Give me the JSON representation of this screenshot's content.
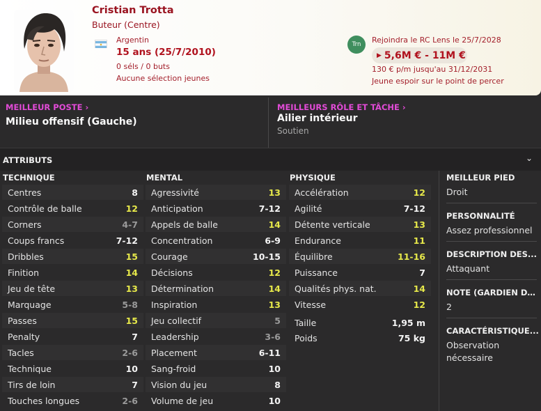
{
  "player": {
    "name": "Cristian Trotta",
    "position": "Buteur (Centre)",
    "nationality": "Argentin",
    "age": "15 ans (25/7/2010)",
    "caps": "0 séls / 0 buts",
    "youth_caps": "Aucune sélection jeunes"
  },
  "transfer": {
    "badge": "Trn",
    "club_move": "Rejoindra le RC Lens le 25/7/2028",
    "value": "5,6M € - 11M €",
    "wage": "130 € p/m jusqu'au 31/12/2031",
    "potential": "Jeune espoir sur le point de percer"
  },
  "best_position": {
    "label": "MEILLEUR POSTE",
    "value": "Milieu offensif (Gauche)"
  },
  "best_role": {
    "label": "MEILLEURS RÔLE ET TÂCHE",
    "value": "Ailier intérieur",
    "duty": "Soutien"
  },
  "attributes": {
    "title": "ATTRIBUTS",
    "technique_label": "TECHNIQUE",
    "mental_label": "MENTAL",
    "physique_label": "PHYSIQUE",
    "technique": [
      {
        "name": "Centres",
        "value": "8",
        "tone": "white"
      },
      {
        "name": "Contrôle de balle",
        "value": "12",
        "tone": "yellow"
      },
      {
        "name": "Corners",
        "value": "4-7",
        "tone": "grey"
      },
      {
        "name": "Coups francs",
        "value": "7-12",
        "tone": "white"
      },
      {
        "name": "Dribbles",
        "value": "15",
        "tone": "yellow"
      },
      {
        "name": "Finition",
        "value": "14",
        "tone": "yellow"
      },
      {
        "name": "Jeu de tête",
        "value": "13",
        "tone": "yellow"
      },
      {
        "name": "Marquage",
        "value": "5-8",
        "tone": "grey"
      },
      {
        "name": "Passes",
        "value": "15",
        "tone": "yellow"
      },
      {
        "name": "Penalty",
        "value": "7",
        "tone": "white"
      },
      {
        "name": "Tacles",
        "value": "2-6",
        "tone": "grey"
      },
      {
        "name": "Technique",
        "value": "10",
        "tone": "white"
      },
      {
        "name": "Tirs de loin",
        "value": "7",
        "tone": "white"
      },
      {
        "name": "Touches longues",
        "value": "2-6",
        "tone": "grey"
      }
    ],
    "mental": [
      {
        "name": "Agressivité",
        "value": "13",
        "tone": "yellow"
      },
      {
        "name": "Anticipation",
        "value": "7-12",
        "tone": "white"
      },
      {
        "name": "Appels de balle",
        "value": "14",
        "tone": "yellow"
      },
      {
        "name": "Concentration",
        "value": "6-9",
        "tone": "white"
      },
      {
        "name": "Courage",
        "value": "10-15",
        "tone": "white"
      },
      {
        "name": "Décisions",
        "value": "12",
        "tone": "yellow"
      },
      {
        "name": "Détermination",
        "value": "14",
        "tone": "yellow"
      },
      {
        "name": "Inspiration",
        "value": "13",
        "tone": "yellow"
      },
      {
        "name": "Jeu collectif",
        "value": "5",
        "tone": "grey"
      },
      {
        "name": "Leadership",
        "value": "3-6",
        "tone": "grey"
      },
      {
        "name": "Placement",
        "value": "6-11",
        "tone": "white"
      },
      {
        "name": "Sang-froid",
        "value": "10",
        "tone": "white"
      },
      {
        "name": "Vision du jeu",
        "value": "8",
        "tone": "white"
      },
      {
        "name": "Volume de jeu",
        "value": "10",
        "tone": "white"
      }
    ],
    "physique": [
      {
        "name": "Accélération",
        "value": "12",
        "tone": "yellow"
      },
      {
        "name": "Agilité",
        "value": "7-12",
        "tone": "white"
      },
      {
        "name": "Détente verticale",
        "value": "13",
        "tone": "yellow"
      },
      {
        "name": "Endurance",
        "value": "11",
        "tone": "yellow"
      },
      {
        "name": "Équilibre",
        "value": "11-16",
        "tone": "yellow"
      },
      {
        "name": "Puissance",
        "value": "7",
        "tone": "white"
      },
      {
        "name": "Qualités phys. nat.",
        "value": "14",
        "tone": "yellow"
      },
      {
        "name": "Vitesse",
        "value": "12",
        "tone": "yellow"
      }
    ],
    "height_label": "Taille",
    "height": "1,95 m",
    "weight_label": "Poids",
    "weight": "75 kg"
  },
  "side": {
    "foot_label": "MEILLEUR PIED",
    "foot": "Droit",
    "personality_label": "PERSONNALITÉ",
    "personality": "Assez professionnel",
    "description_label": "DESCRIPTION DES...",
    "description": "Attaquant",
    "gk_label": "NOTE (GARDIEN DE...",
    "gk": "2",
    "traits_label": "CARACTÉRISTIQUE...",
    "traits": "Observation nécessaire"
  },
  "colors": {
    "accent_magenta": "#e24bd7",
    "header_red": "#9a1320",
    "attr_yellow": "#e6e84a",
    "attr_grey": "#9a9a9a",
    "background": "#2b2a2b"
  }
}
